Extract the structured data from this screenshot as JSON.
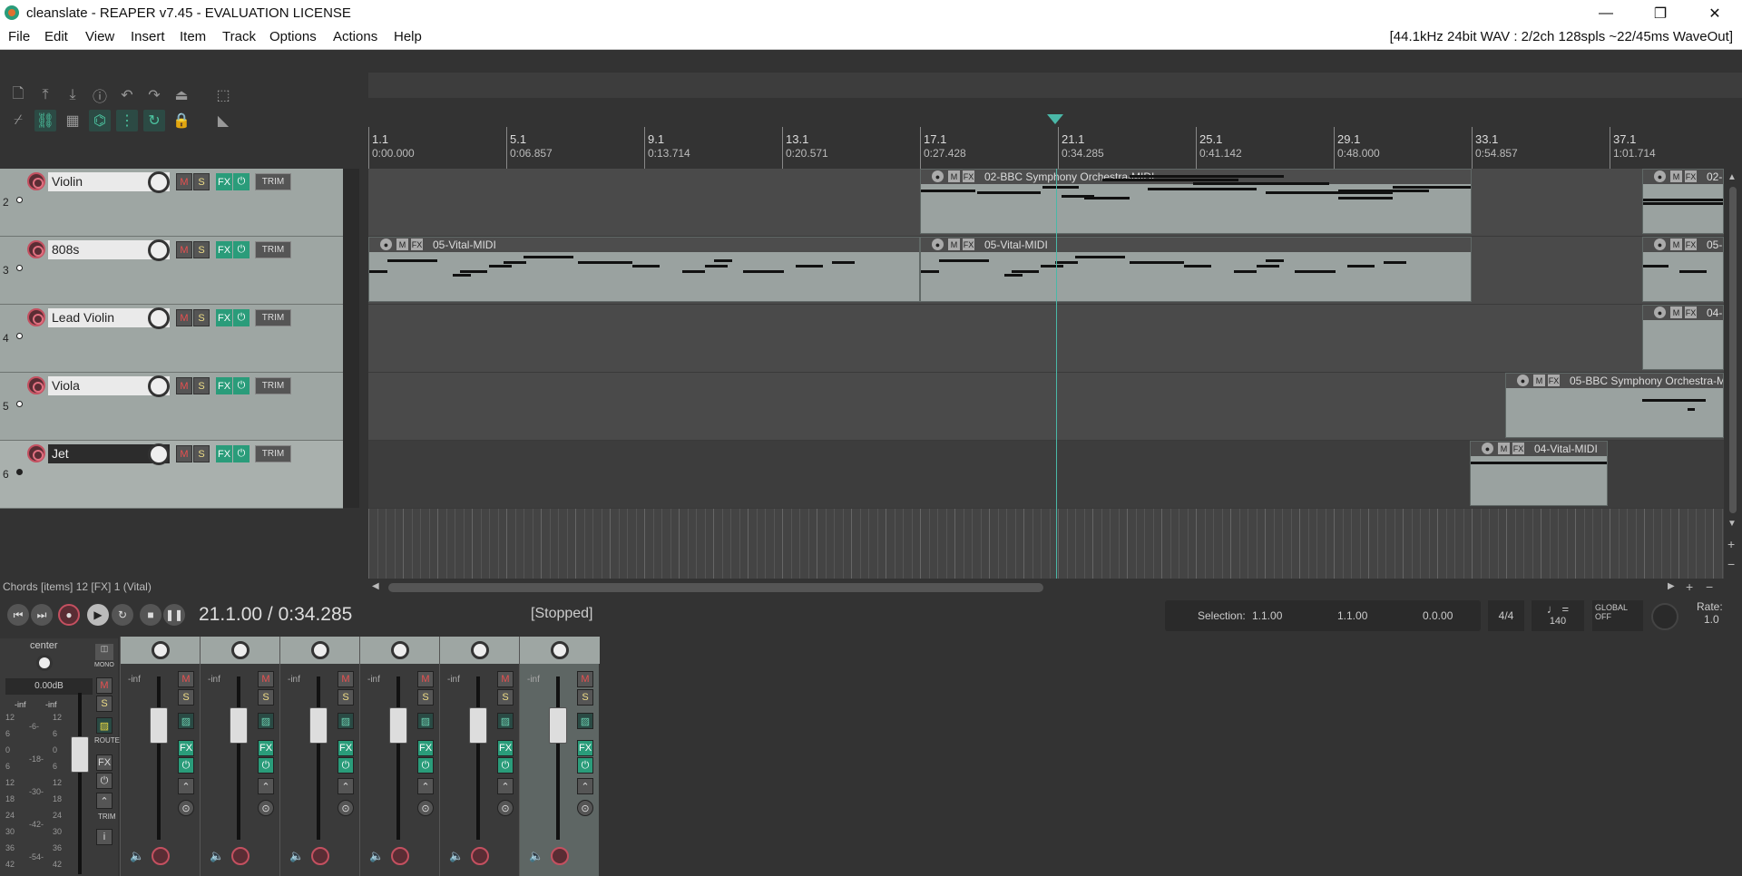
{
  "window": {
    "title": "cleanslate - REAPER v7.45 - EVALUATION LICENSE",
    "minimize": "—",
    "restore": "❐",
    "close": "✕"
  },
  "menu": [
    "File",
    "Edit",
    "View",
    "Insert",
    "Item",
    "Track",
    "Options",
    "Actions",
    "Help"
  ],
  "audio_status": "[44.1kHz 24bit WAV : 2/2ch 128spls ~22/45ms WaveOut]",
  "ruler": [
    {
      "bar": "1.1",
      "time": "0:00.000"
    },
    {
      "bar": "5.1",
      "time": "0:06.857"
    },
    {
      "bar": "9.1",
      "time": "0:13.714"
    },
    {
      "bar": "13.1",
      "time": "0:20.571"
    },
    {
      "bar": "17.1",
      "time": "0:27.428"
    },
    {
      "bar": "21.1",
      "time": "0:34.285"
    },
    {
      "bar": "25.1",
      "time": "0:41.142"
    },
    {
      "bar": "29.1",
      "time": "0:48.000"
    },
    {
      "bar": "33.1",
      "time": "0:54.857"
    },
    {
      "bar": "37.1",
      "time": "1:01.714"
    }
  ],
  "tracks": [
    {
      "num": "2",
      "name": "Violin",
      "m": "M",
      "s": "S",
      "fx": "FX",
      "pw": "⏻",
      "trim": "TRIM"
    },
    {
      "num": "3",
      "name": "808s",
      "m": "M",
      "s": "S",
      "fx": "FX",
      "pw": "⏻",
      "trim": "TRIM"
    },
    {
      "num": "4",
      "name": "Lead Violin",
      "m": "M",
      "s": "S",
      "fx": "FX",
      "pw": "⏻",
      "trim": "TRIM"
    },
    {
      "num": "5",
      "name": "Viola",
      "m": "M",
      "s": "S",
      "fx": "FX",
      "pw": "⏻",
      "trim": "TRIM"
    },
    {
      "num": "6",
      "name": "Jet",
      "m": "M",
      "s": "S",
      "fx": "FX",
      "pw": "⏻",
      "trim": "TRIM"
    }
  ],
  "items": {
    "violin_main": "02-BBC Symphony Orchestra-MIDI",
    "violin_end": "02-",
    "808_a": "05-Vital-MIDI",
    "808_b": "05-Vital-MIDI",
    "808_end": "05-",
    "lead_end": "04-",
    "viola": "05-BBC Symphony Orchestra-M",
    "jet": "04-Vital-MIDI",
    "btn_m": "M",
    "btn_fx": "FX"
  },
  "statusline": "Chords [items] 12 [FX] 1 (Vital)",
  "transport": {
    "position": "21.1.00 / 0:34.285",
    "state": "[Stopped]",
    "selection_label": "Selection:",
    "sel_start": "1.1.00",
    "sel_end": "1.1.00",
    "sel_len": "0.0.00",
    "timesig": "4/4",
    "tempo_icon": "♩ =",
    "tempo": "140",
    "global_label": "GLOBAL",
    "global_state": "OFF",
    "rate_label": "Rate:",
    "rate": "1.0"
  },
  "master": {
    "pan": "center",
    "vol": "0.00dB",
    "inf_l": "-inf",
    "inf_r": "-inf",
    "mono": "MONO",
    "m": "M",
    "s": "S",
    "route": "ROUTE",
    "fx": "FX",
    "trim": "TRIM",
    "info": "i",
    "scale": [
      "12",
      "6",
      "0",
      "6",
      "12",
      "18",
      "24",
      "30",
      "36",
      "42"
    ],
    "scale_mid": [
      "-6-",
      "-18-",
      "-30-",
      "-42-",
      "-54-"
    ]
  },
  "mixer_channels": [
    {
      "inf": "-inf",
      "m": "M",
      "s": "S",
      "fx": "FX"
    },
    {
      "inf": "-inf",
      "m": "M",
      "s": "S",
      "fx": "FX"
    },
    {
      "inf": "-inf",
      "m": "M",
      "s": "S",
      "fx": "FX"
    },
    {
      "inf": "-inf",
      "m": "M",
      "s": "S",
      "fx": "FX"
    },
    {
      "inf": "-inf",
      "m": "M",
      "s": "S",
      "fx": "FX"
    },
    {
      "inf": "-inf",
      "m": "M",
      "s": "S",
      "fx": "FX"
    }
  ],
  "colors": {
    "accent": "#2a9c7a",
    "playhead": "#4ab8a8",
    "item": "#9aa2a0",
    "track": "#9ea6a3",
    "record": "#c45060"
  }
}
